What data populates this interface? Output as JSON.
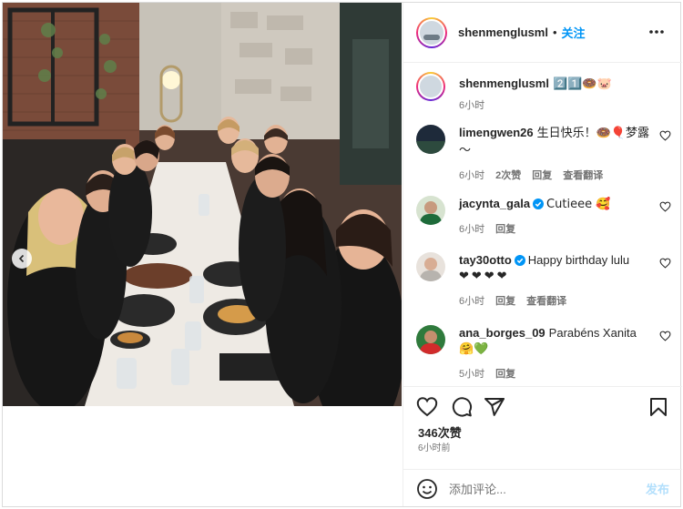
{
  "post": {
    "username": "shenmenglusml",
    "follow_label": "关注",
    "dot": "•",
    "caption_text": "2️⃣1️⃣🍩🐷",
    "caption_time": "6小时"
  },
  "comments": [
    {
      "username": "limengwen26",
      "text": "生日快乐！🍩🎈梦露～",
      "time": "6小时",
      "likes": "2次赞",
      "reply": "回复",
      "translate": "查看翻译",
      "verified": false
    },
    {
      "username": "jacynta_gala",
      "text": "Cutieee 🥰",
      "time": "6小时",
      "reply": "回复",
      "verified": true
    },
    {
      "username": "tay30otto",
      "text": "Happy birthday lulu",
      "text2": "❤❤❤❤",
      "time": "6小时",
      "reply": "回复",
      "translate": "查看翻译",
      "verified": true
    },
    {
      "username": "ana_borges_09",
      "text": "Parabéns Xanita",
      "text2": "🤗💚",
      "time": "5小时",
      "reply": "回复",
      "verified": false
    }
  ],
  "actions": {
    "likes": "346次赞",
    "time": "6小时前",
    "comment_placeholder": "添加评论...",
    "post_label": "发布"
  },
  "icons": {
    "like": "heart-icon",
    "comment": "comment-icon",
    "share": "share-icon",
    "save": "bookmark-icon",
    "more": "more-icon",
    "emoji": "smile-icon",
    "prev": "chevron-left-icon"
  },
  "colors": {
    "accent": "#0095f6",
    "text": "#262626",
    "muted": "#737373",
    "border": "#dbdbdb",
    "post_disabled": "#b2dffc"
  }
}
